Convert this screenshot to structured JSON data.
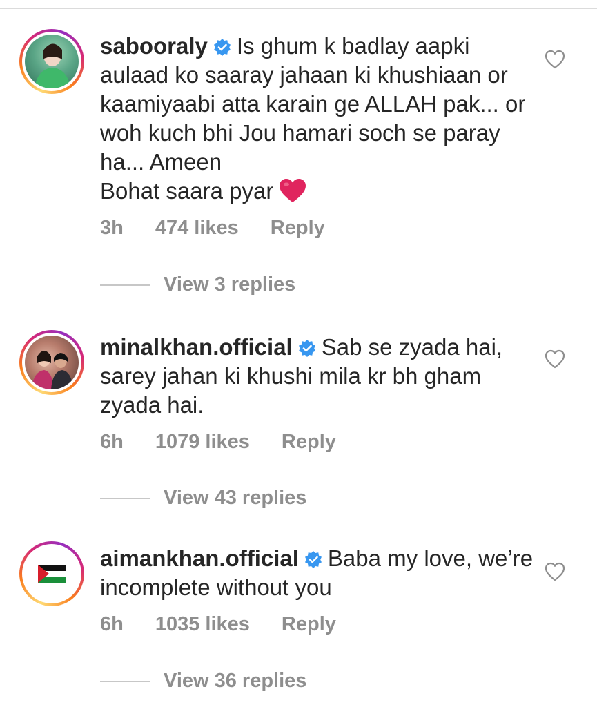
{
  "comments": [
    {
      "username": "sabooraly",
      "verified": true,
      "text": "Is ghum k badlay aapki aulaad ko saaray jahaan ki khushiaan or kaamiyaabi atta karain ge ALLAH pak... or woh kuch bhi Jou hamari soch se paray ha... Ameen",
      "text_line2": "Bohat saara pyar",
      "emoji": "red-heart",
      "time": "3h",
      "likes": "474 likes",
      "reply_label": "Reply",
      "view_replies": "View 3 replies"
    },
    {
      "username": "minalkhan.official",
      "verified": true,
      "text": "Sab se zyada hai, sarey jahan ki khushi mila kr bh gham zyada hai.",
      "time": "6h",
      "likes": "1079 likes",
      "reply_label": "Reply",
      "view_replies": "View 43 replies"
    },
    {
      "username": "aimankhan.official",
      "verified": true,
      "text": "Baba my love, we’re incomplete without you",
      "time": "6h",
      "likes": "1035 likes",
      "reply_label": "Reply",
      "view_replies": "View 36 replies"
    }
  ],
  "colors": {
    "text": "#262626",
    "meta": "#8e8e8e",
    "verified": "#3897f0",
    "heart_emoji": "#e0245e"
  }
}
